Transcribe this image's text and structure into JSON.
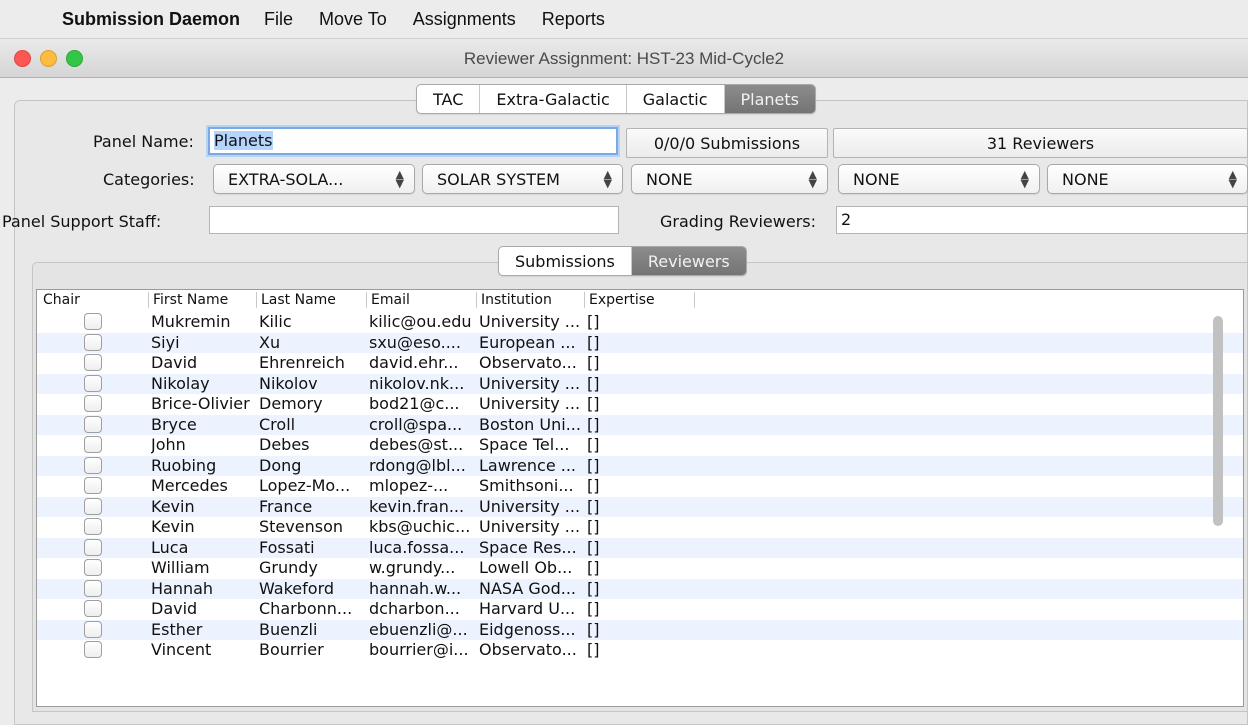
{
  "menubar": {
    "app_name": "Submission Daemon",
    "items": [
      "File",
      "Move To",
      "Assignments",
      "Reports"
    ]
  },
  "window": {
    "title": "Reviewer Assignment: HST-23 Mid-Cycle2"
  },
  "main_tabs": {
    "items": [
      "TAC",
      "Extra-Galactic",
      "Galactic",
      "Planets"
    ],
    "active": "Planets"
  },
  "form": {
    "panel_name_label": "Panel Name:",
    "panel_name_value": "Planets",
    "submissions_count": "0/0/0 Submissions",
    "reviewers_count": "31 Reviewers",
    "categories_label": "Categories:",
    "categories": [
      "EXTRA-SOLA...",
      "SOLAR SYSTEM",
      "NONE",
      "NONE",
      "NONE"
    ],
    "support_label": "Panel Support Staff:",
    "support_value": "",
    "grading_label": "Grading Reviewers:",
    "grading_value": "2"
  },
  "sub_tabs": {
    "items": [
      "Submissions",
      "Reviewers"
    ],
    "active": "Reviewers"
  },
  "table": {
    "columns": [
      "Chair",
      "First Name",
      "Last Name",
      "Email",
      "Institution",
      "Expertise"
    ],
    "rows": [
      {
        "first": "Mukremin",
        "last": "Kilic",
        "email": "kilic@ou.edu",
        "institution": "University ...",
        "expertise": "[]"
      },
      {
        "first": "Siyi",
        "last": "Xu",
        "email": "sxu@eso....",
        "institution": "European ...",
        "expertise": "[]"
      },
      {
        "first": "David",
        "last": "Ehrenreich",
        "email": "david.ehr...",
        "institution": "Observato...",
        "expertise": "[]"
      },
      {
        "first": "Nikolay",
        "last": "Nikolov",
        "email": "nikolov.nk...",
        "institution": "University ...",
        "expertise": "[]"
      },
      {
        "first": "Brice-Olivier",
        "last": "Demory",
        "email": "bod21@c...",
        "institution": "University ...",
        "expertise": "[]"
      },
      {
        "first": "Bryce",
        "last": "Croll",
        "email": "croll@spa...",
        "institution": "Boston Uni...",
        "expertise": "[]"
      },
      {
        "first": "John",
        "last": "Debes",
        "email": "debes@st...",
        "institution": "Space Tel...",
        "expertise": "[]"
      },
      {
        "first": "Ruobing",
        "last": "Dong",
        "email": "rdong@lbl...",
        "institution": "Lawrence ...",
        "expertise": "[]"
      },
      {
        "first": "Mercedes",
        "last": "Lopez-Mo...",
        "email": "mlopez-...",
        "institution": "Smithsoni...",
        "expertise": "[]"
      },
      {
        "first": "Kevin",
        "last": "France",
        "email": "kevin.fran...",
        "institution": "University ...",
        "expertise": "[]"
      },
      {
        "first": "Kevin",
        "last": "Stevenson",
        "email": "kbs@uchic...",
        "institution": "University ...",
        "expertise": "[]"
      },
      {
        "first": "Luca",
        "last": "Fossati",
        "email": "luca.fossa...",
        "institution": "Space Res...",
        "expertise": "[]"
      },
      {
        "first": "William",
        "last": "Grundy",
        "email": "w.grundy...",
        "institution": "Lowell Ob...",
        "expertise": "[]"
      },
      {
        "first": "Hannah",
        "last": "Wakeford",
        "email": "hannah.w...",
        "institution": "NASA God...",
        "expertise": "[]"
      },
      {
        "first": "David",
        "last": "Charbonn...",
        "email": "dcharbon...",
        "institution": "Harvard U...",
        "expertise": "[]"
      },
      {
        "first": "Esther",
        "last": "Buenzli",
        "email": "ebuenzli@...",
        "institution": "Eidgenoss...",
        "expertise": "[]"
      },
      {
        "first": "Vincent",
        "last": "Bourrier",
        "email": "bourrier@i...",
        "institution": "Observato...",
        "expertise": "[]"
      }
    ]
  }
}
